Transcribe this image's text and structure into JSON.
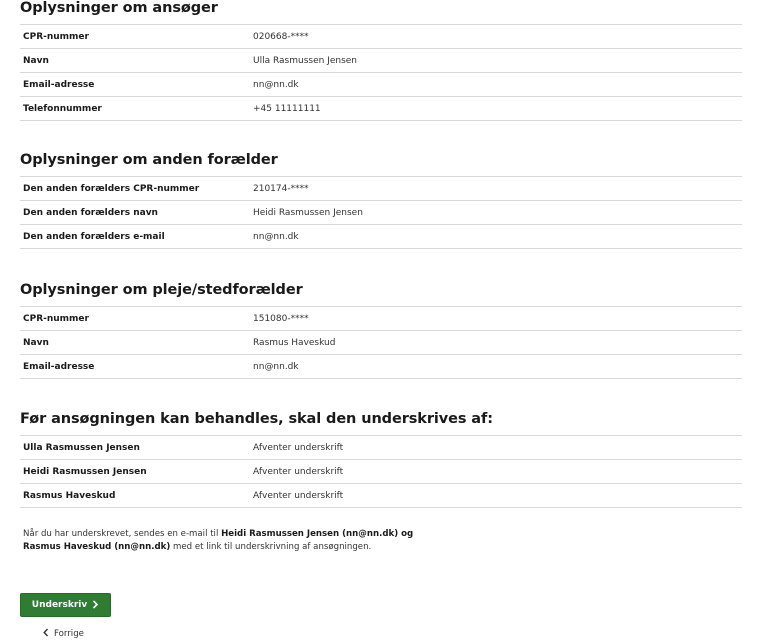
{
  "applicant": {
    "title": "Oplysninger om ansøger",
    "rows": [
      {
        "label": "CPR-nummer",
        "value": "020668-****"
      },
      {
        "label": "Navn",
        "value": "Ulla Rasmussen Jensen"
      },
      {
        "label": "Email-adresse",
        "value": "nn@nn.dk"
      },
      {
        "label": "Telefonnummer",
        "value": "+45 11111111"
      }
    ]
  },
  "other_parent": {
    "title": "Oplysninger om anden forælder",
    "rows": [
      {
        "label": "Den anden forælders CPR-nummer",
        "value": "210174-****"
      },
      {
        "label": "Den anden forælders navn",
        "value": "Heidi Rasmussen Jensen"
      },
      {
        "label": "Den anden forælders e-mail",
        "value": "nn@nn.dk"
      }
    ]
  },
  "foster_parent": {
    "title": "Oplysninger om pleje/stedforælder",
    "rows": [
      {
        "label": "CPR-nummer",
        "value": "151080-****"
      },
      {
        "label": "Navn",
        "value": "Rasmus Haveskud"
      },
      {
        "label": "Email-adresse",
        "value": "nn@nn.dk"
      }
    ]
  },
  "signatures": {
    "title": "Før ansøgningen kan behandles, skal den underskrives af:",
    "rows": [
      {
        "label": "Ulla Rasmussen Jensen",
        "value": "Afventer underskrift"
      },
      {
        "label": "Heidi Rasmussen Jensen",
        "value": "Afventer underskrift"
      },
      {
        "label": "Rasmus Haveskud",
        "value": "Afventer underskrift"
      }
    ]
  },
  "note": {
    "part1": "Når du har underskrevet, sendes en e-mail til ",
    "bold1": "Heidi Rasmussen Jensen (nn@nn.dk) og",
    "bold2": "Rasmus Haveskud (nn@nn.dk)",
    "part2": " med et link til underskrivning af ansøgningen."
  },
  "actions": {
    "sign_label": "Underskriv",
    "back_label": "Forrige"
  },
  "colors": {
    "primary_button": "#2e7d32"
  },
  "icons": {
    "sign_chevron": "chevron-right-icon",
    "back_chevron": "chevron-left-icon"
  }
}
